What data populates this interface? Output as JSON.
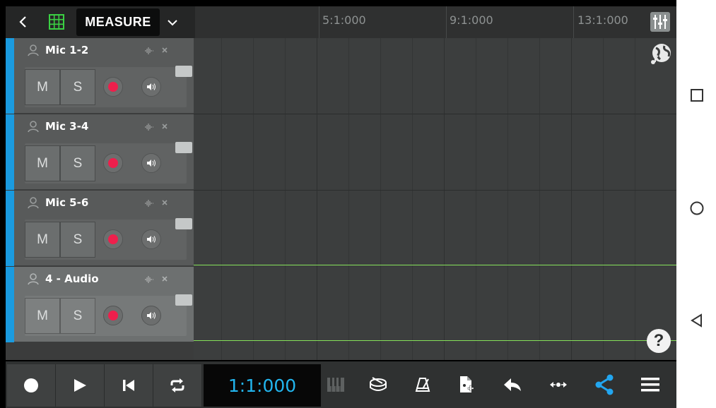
{
  "topbar": {
    "timebase_label": "MEASURE",
    "ruler_labels": [
      "5:1:000",
      "9:1:000",
      "13:1:000"
    ]
  },
  "tracks": [
    {
      "name": "Mic 1-2",
      "mute_label": "M",
      "solo_label": "S",
      "selected": false
    },
    {
      "name": "Mic 3-4",
      "mute_label": "M",
      "solo_label": "S",
      "selected": false
    },
    {
      "name": "Mic 5-6",
      "mute_label": "M",
      "solo_label": "S",
      "selected": false
    },
    {
      "name": "4 - Audio",
      "mute_label": "M",
      "solo_label": "S",
      "selected": true
    }
  ],
  "transport": {
    "timecode": "1:1:000"
  },
  "help": {
    "label": "?"
  },
  "colors": {
    "track_strip": "#1a9be0",
    "record": "#ee1f4c",
    "timecode": "#22b5ee",
    "share": "#22a6f0",
    "loop_line": "#86e25a"
  }
}
